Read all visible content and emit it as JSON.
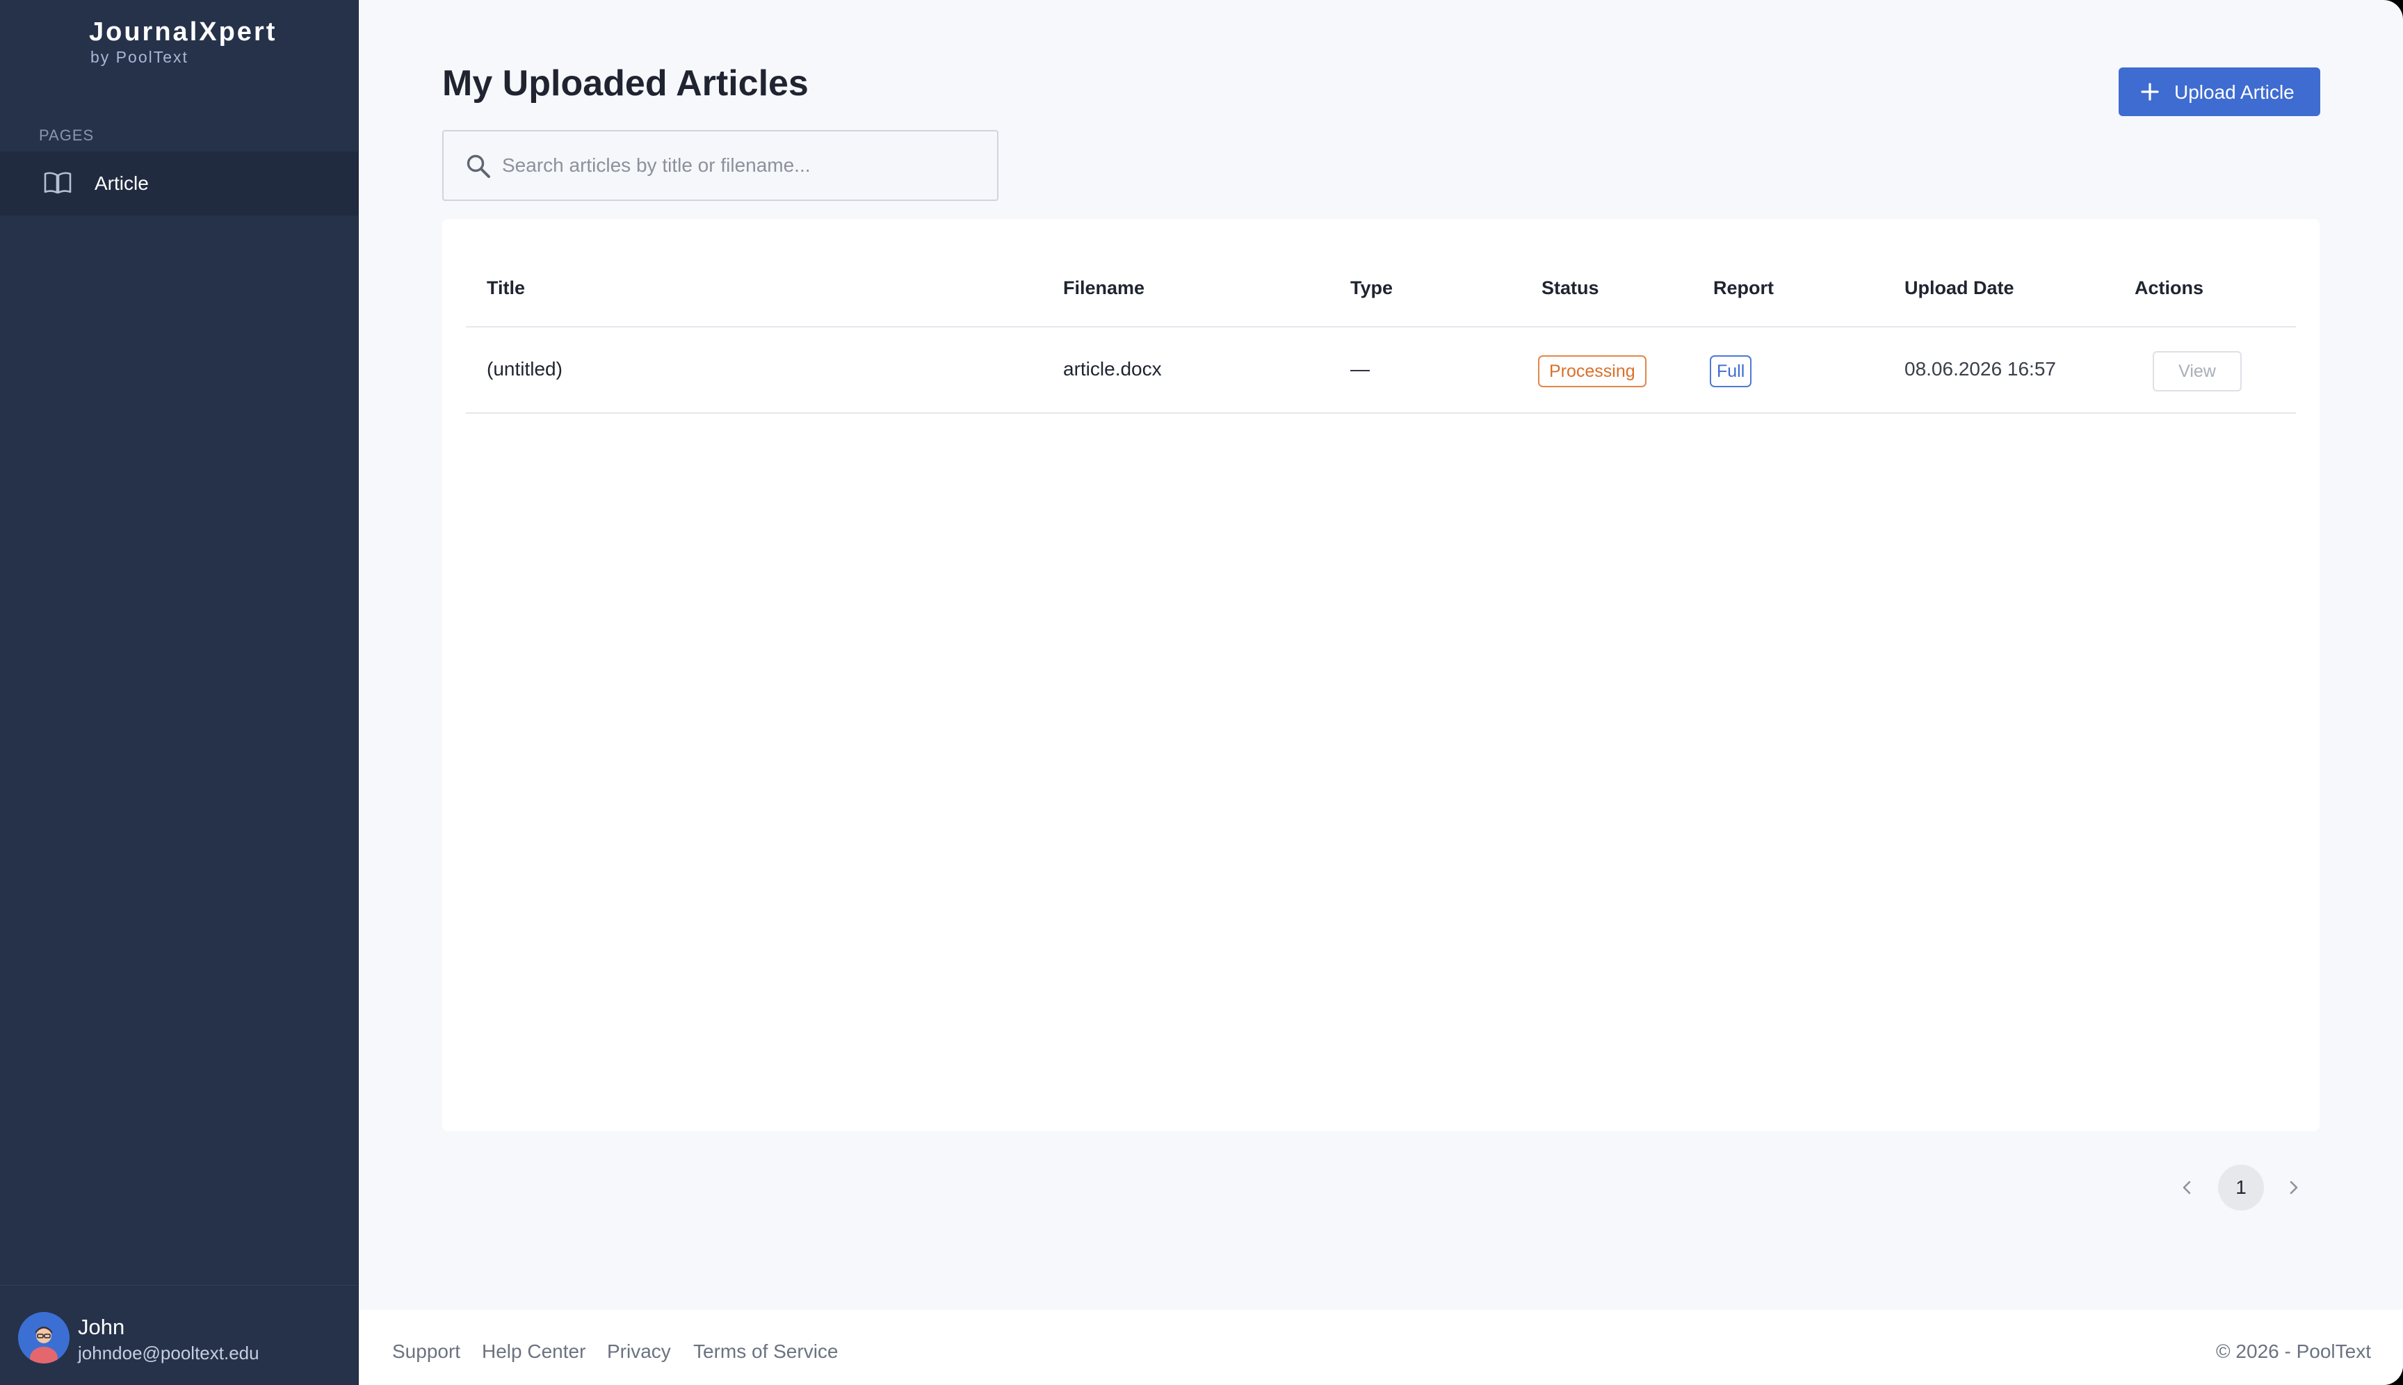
{
  "app": {
    "brand_name": "JournalXpert",
    "brand_sub": "by PoolText"
  },
  "sidebar": {
    "section_label": "PAGES",
    "items": [
      {
        "label": "Article",
        "icon": "book-open-icon",
        "active": true
      }
    ],
    "user": {
      "name": "John",
      "email": "johndoe@pooltext.edu",
      "avatar_icon": "user-avatar-icon"
    }
  },
  "main": {
    "title": "My Uploaded Articles",
    "upload_button_label": "Upload Article",
    "search": {
      "placeholder": "Search articles by title or filename...",
      "value": ""
    },
    "table": {
      "columns": [
        "Title",
        "Filename",
        "Type",
        "Status",
        "Report",
        "Upload Date",
        "Actions"
      ],
      "rows": [
        {
          "title": "(untitled)",
          "filename": "article.docx",
          "type": "—",
          "status": "Processing",
          "report": "Full",
          "upload_date": "08.06.2026 16:57",
          "action": "View"
        }
      ]
    },
    "pagination": {
      "current_page": "1"
    }
  },
  "footer": {
    "links": [
      "Support",
      "Help Center",
      "Privacy",
      "Terms of Service"
    ],
    "copyright": "© 2026 - PoolText"
  },
  "colors": {
    "sidebar_bg": "#26324a",
    "accent": "#3f6cd1",
    "status_processing": "#d9702c",
    "page_bg": "#f7f8fb"
  }
}
